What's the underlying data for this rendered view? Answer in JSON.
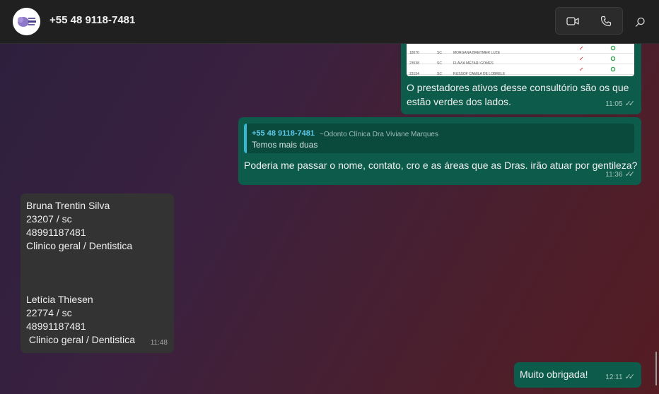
{
  "header": {
    "contact_name": "+55 48 9118-7481",
    "avatar_icon": "clinic-logo",
    "video_icon": "video-camera-icon",
    "phone_icon": "phone-icon",
    "search_icon": "search-icon"
  },
  "image_rows": [
    {
      "col1": "18070",
      "col2": "SC",
      "col3": "MORGANA BREHMER LUZE"
    },
    {
      "col1": "23538",
      "col2": "SC",
      "col3": "FLAVIA MEZARI GOMES"
    },
    {
      "col1": "23154",
      "col2": "SC",
      "col3": "RUSSOF CAMILA DE LOBRELE"
    }
  ],
  "messages": [
    {
      "direction": "out",
      "text": "O prestadores ativos desse consultório são os que estão verdes dos lados.",
      "time": "11:05"
    },
    {
      "direction": "out",
      "quote": {
        "author": "+55 48 9118-7481",
        "author_sub": "~Odonto Clínica Dra Viviane Marques",
        "text": "Temos mais duas"
      },
      "text": "Poderia me passar o nome, contato, cro e as áreas que as Dras. irão atuar por gentileza?",
      "time": "11:36"
    },
    {
      "direction": "in",
      "lines": [
        "Bruna Trentin Silva",
        "23207 / sc",
        "48991187481",
        "Clinico geral / Dentistica",
        "Letícia Thiesen",
        "22774 / sc",
        "48991187481",
        " Clinico geral / Dentistica"
      ],
      "time": "11:48"
    },
    {
      "direction": "out",
      "text": "Muito obrigada!",
      "time": "12:11"
    }
  ]
}
